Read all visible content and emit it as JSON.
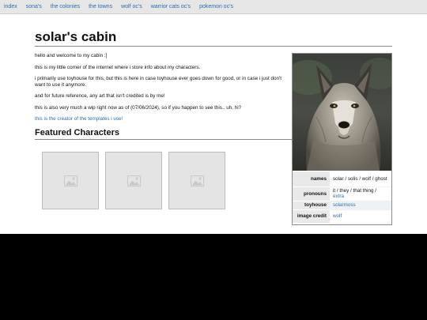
{
  "nav": {
    "items": [
      "index",
      "sona's",
      "the colonies",
      "the towns",
      "wolf oc's",
      "warrior cats oc's",
      "pokemon oc's"
    ]
  },
  "page": {
    "title": "solar's cabin",
    "intro": [
      "hello and welcome to my cabin :]",
      "this is my little corner of the internet where i store info about my characters.",
      "i primarily use toyhouse for this, but this is here in case toyhouse ever goes down for good, or in case i just don't want to use it anymore.",
      "and for future reference, any art that isn't credited is by me!",
      "this is also very much a wip right now as of (07/06/2024), so if you happen to see this.. uh, hi?"
    ],
    "credit_link": "this is the creator of the templates i use!",
    "featured_title": "Featured Characters"
  },
  "infobox": {
    "image_icon": "wolf-photo",
    "rows": [
      {
        "label": "names",
        "value": "solar / solis / wolf / ghost"
      },
      {
        "label": "pronouns",
        "value": "it / they / that thing /",
        "link": "extra"
      },
      {
        "label": "toyhouse",
        "link": "solarmoss"
      },
      {
        "label": "image credit",
        "link": "wolf"
      }
    ]
  },
  "colors": {
    "link": "#2b6cb0",
    "nav_bg": "#e6e6e6",
    "page_bg": "#ffffff",
    "thumb_bg": "#e4e4e4"
  }
}
